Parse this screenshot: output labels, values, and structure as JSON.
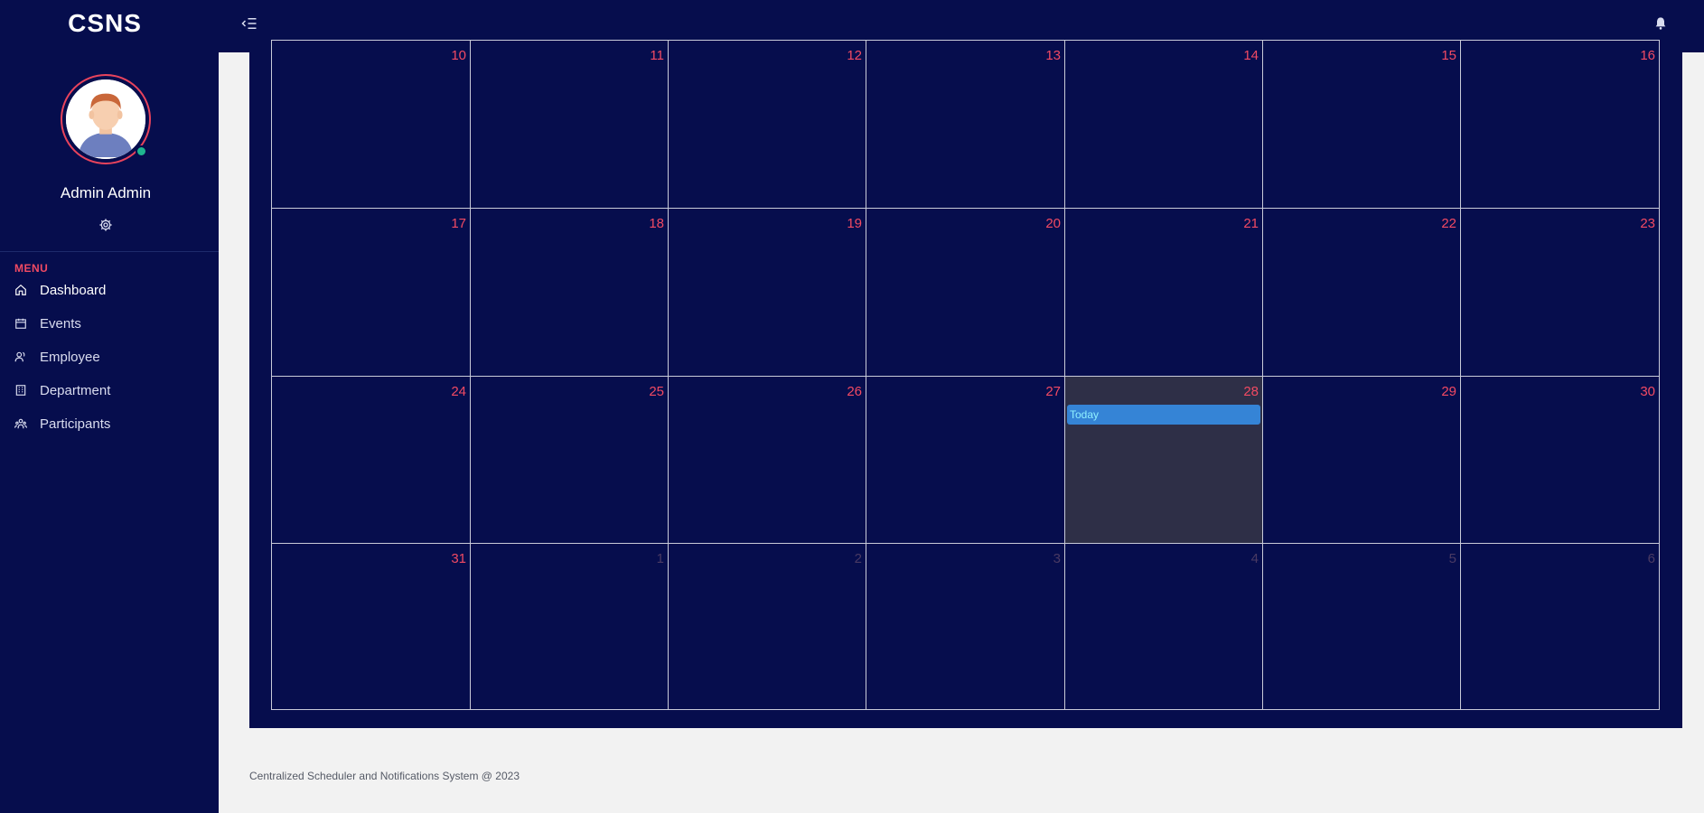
{
  "app": {
    "brand": "CSNS"
  },
  "user": {
    "name": "Admin Admin"
  },
  "menu": {
    "title": "MENU",
    "items": [
      {
        "label": "Dashboard",
        "icon": "home-icon",
        "active": true
      },
      {
        "label": "Events",
        "icon": "calendar-icon",
        "active": false
      },
      {
        "label": "Employee",
        "icon": "users-icon",
        "active": false
      },
      {
        "label": "Department",
        "icon": "building-icon",
        "active": false
      },
      {
        "label": "Participants",
        "icon": "group-icon",
        "active": false
      }
    ]
  },
  "calendar": {
    "weeks": [
      [
        {
          "day": "10"
        },
        {
          "day": "11"
        },
        {
          "day": "12"
        },
        {
          "day": "13"
        },
        {
          "day": "14"
        },
        {
          "day": "15"
        },
        {
          "day": "16"
        }
      ],
      [
        {
          "day": "17"
        },
        {
          "day": "18"
        },
        {
          "day": "19"
        },
        {
          "day": "20"
        },
        {
          "day": "21"
        },
        {
          "day": "22"
        },
        {
          "day": "23"
        }
      ],
      [
        {
          "day": "24"
        },
        {
          "day": "25"
        },
        {
          "day": "26"
        },
        {
          "day": "27"
        },
        {
          "day": "28",
          "today": true,
          "event": "Today"
        },
        {
          "day": "29"
        },
        {
          "day": "30"
        }
      ],
      [
        {
          "day": "31"
        },
        {
          "day": "1",
          "muted": true
        },
        {
          "day": "2",
          "muted": true
        },
        {
          "day": "3",
          "muted": true
        },
        {
          "day": "4",
          "muted": true
        },
        {
          "day": "5",
          "muted": true
        },
        {
          "day": "6",
          "muted": true
        }
      ]
    ]
  },
  "footer": {
    "text": "Centralized Scheduler and Notifications System @ 2023"
  },
  "colors": {
    "sidebar_bg": "#060d4d",
    "accent": "#f24a63",
    "event": "#3584d6",
    "today_cell": "#2e2f47"
  }
}
